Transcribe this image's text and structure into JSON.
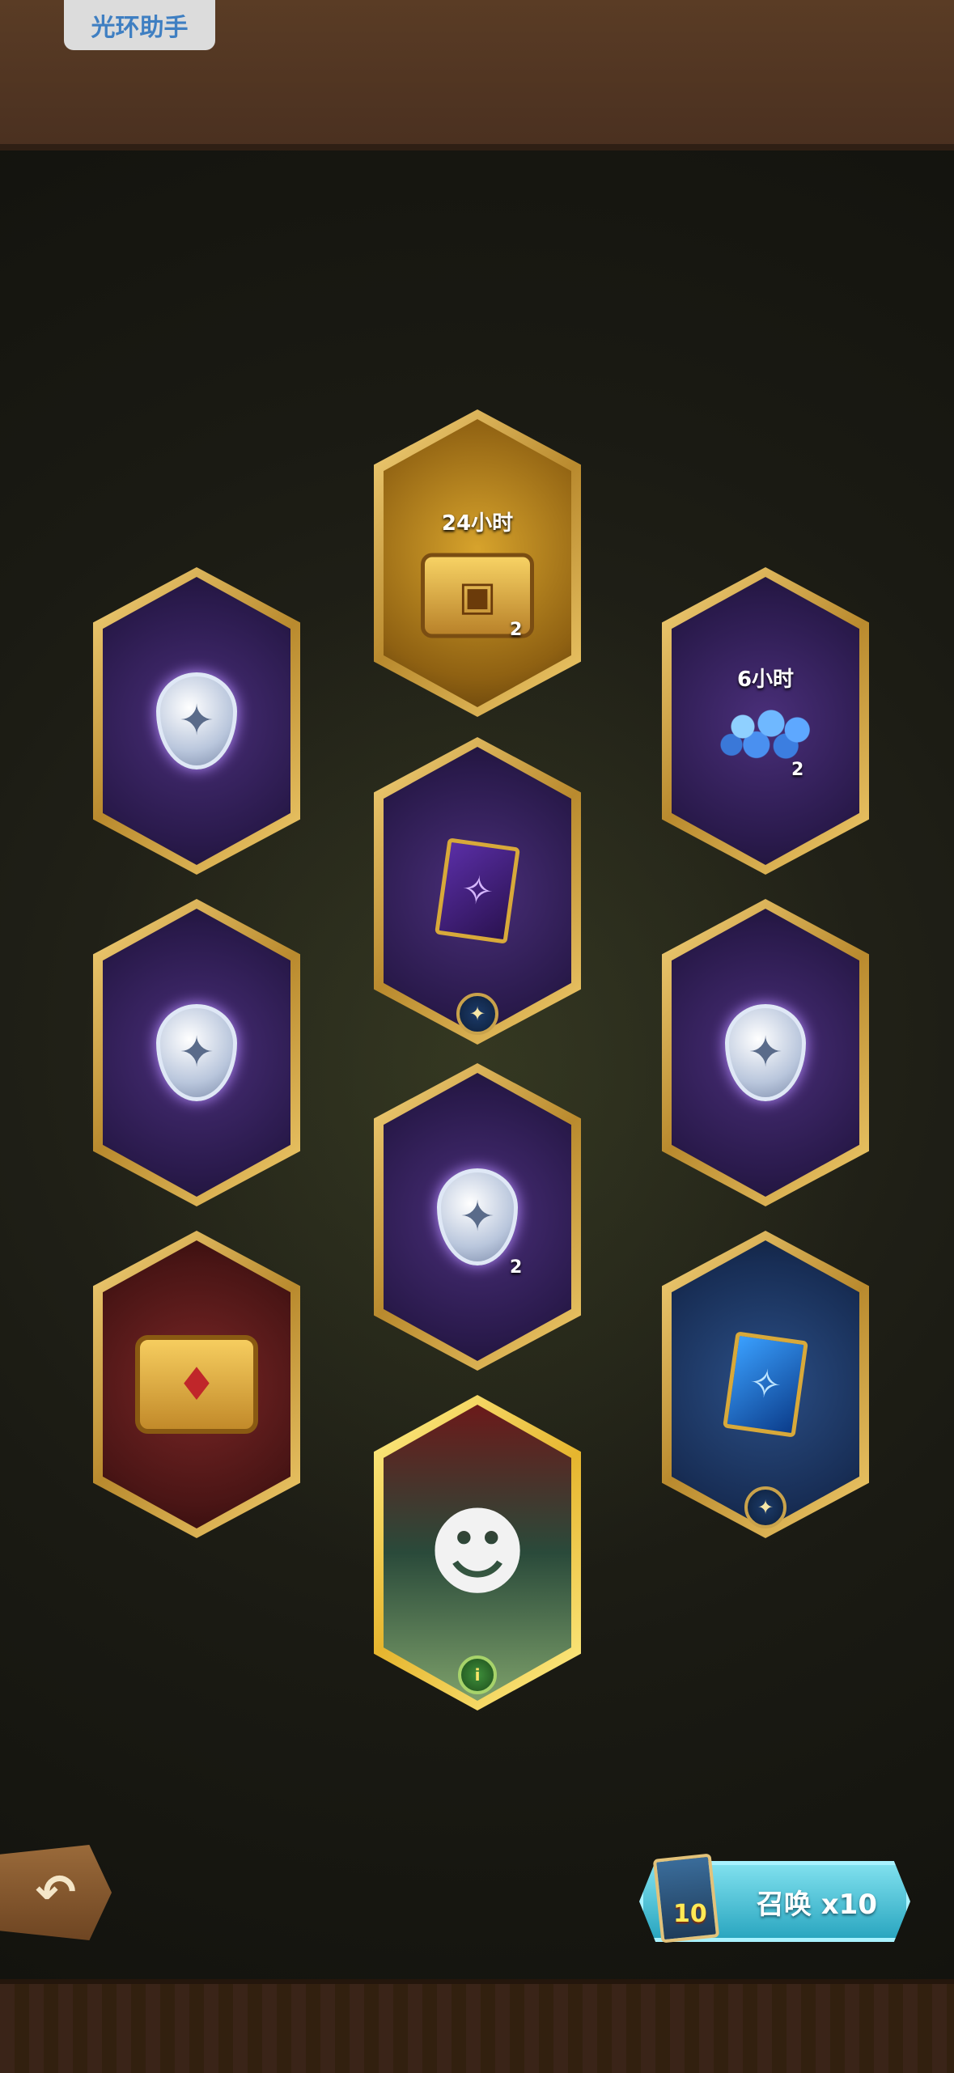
{
  "header": {
    "assist_label": "光环助手"
  },
  "tiles": {
    "t1": {
      "time": "24小时",
      "count": "2"
    },
    "t3": {
      "time": "6小时",
      "count": "2"
    },
    "t8": {
      "count": "2"
    }
  },
  "footer": {
    "summon_label": "召唤 x10",
    "ticket_count": "10"
  },
  "icons": {
    "back": "back-arrow-icon",
    "shield": "shield-token-icon",
    "card": "card-icon",
    "chest": "chest-icon",
    "gems": "gem-pile-icon",
    "hero": "hero-portrait",
    "badge": "star-badge-icon"
  },
  "colors": {
    "gold_frame": "#f4d27a",
    "purple_tile": "#4a2f7a",
    "summon_button": "#2aa6c0"
  }
}
